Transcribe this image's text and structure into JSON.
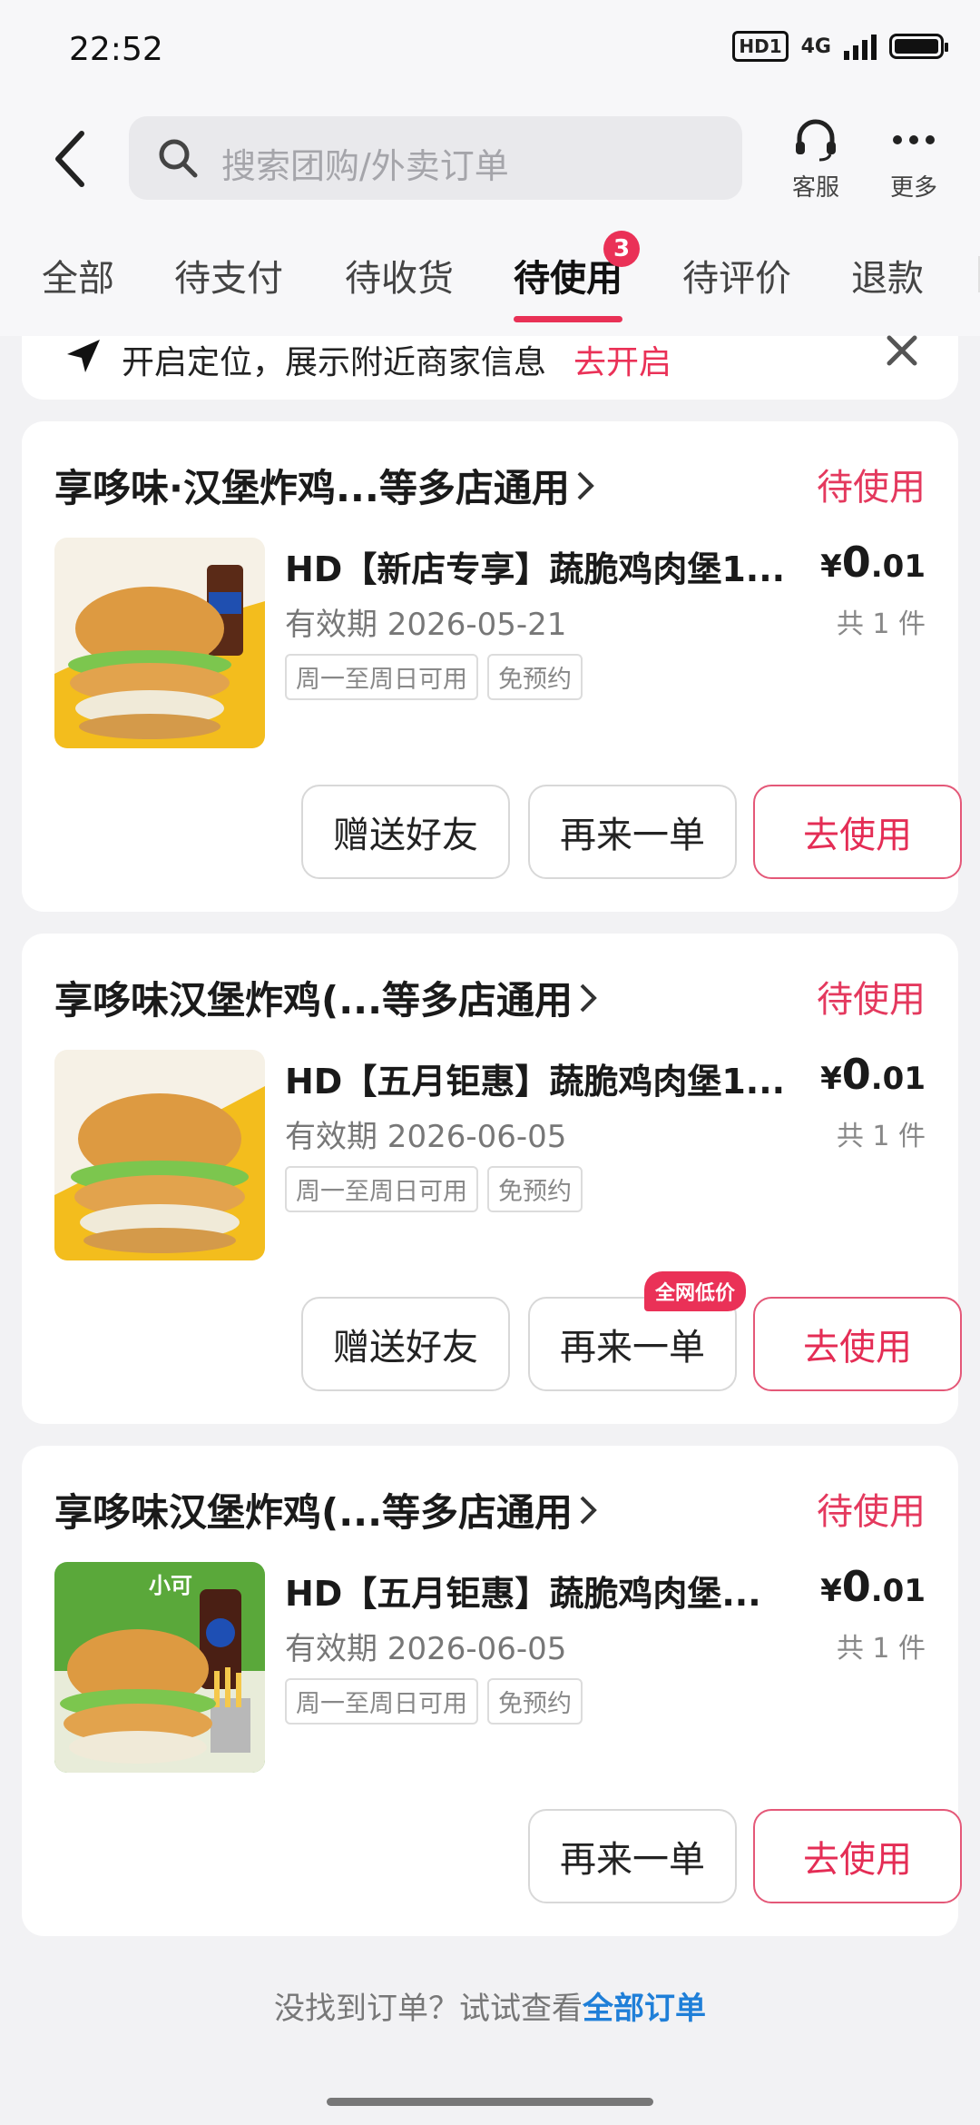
{
  "status_bar": {
    "time": "22:52",
    "hd_label": "HD1",
    "network": "4G"
  },
  "header": {
    "search_placeholder": "搜索团购/外卖订单",
    "service_label": "客服",
    "more_label": "更多"
  },
  "tabs": [
    {
      "label": "全部"
    },
    {
      "label": "待支付"
    },
    {
      "label": "待收货"
    },
    {
      "label": "待使用",
      "active": true,
      "badge": "3"
    },
    {
      "label": "待评价"
    },
    {
      "label": "退款"
    }
  ],
  "location_banner": {
    "text": "开启定位，展示附近商家信息",
    "action": "去开启"
  },
  "orders": [
    {
      "shop": "享哆味·汉堡炸鸡...等多店通用",
      "status": "待使用",
      "product": "HD【新店专享】蔬脆鸡肉堡1...",
      "price_currency": "¥",
      "price_int": "0",
      "price_dec": ".01",
      "quantity": "共 1 件",
      "validity": "有效期 2026-05-21",
      "tags": [
        "周一至周日可用",
        "免预约"
      ],
      "buttons": {
        "gift": "赠送好友",
        "reorder": "再来一单",
        "use": "去使用"
      }
    },
    {
      "shop": "享哆味汉堡炸鸡(...等多店通用",
      "status": "待使用",
      "product": "HD【五月钜惠】蔬脆鸡肉堡1...",
      "price_currency": "¥",
      "price_int": "0",
      "price_dec": ".01",
      "quantity": "共 1 件",
      "validity": "有效期 2026-06-05",
      "tags": [
        "周一至周日可用",
        "免预约"
      ],
      "promo": "全网低价",
      "buttons": {
        "gift": "赠送好友",
        "reorder": "再来一单",
        "use": "去使用"
      }
    },
    {
      "shop": "享哆味汉堡炸鸡(...等多店通用",
      "status": "待使用",
      "product": "HD【五月钜惠】蔬脆鸡肉堡...",
      "price_currency": "¥",
      "price_int": "0",
      "price_dec": ".01",
      "quantity": "共 1 件",
      "validity": "有效期 2026-06-05",
      "tags": [
        "周一至周日可用",
        "免预约"
      ],
      "image_text": "小可",
      "buttons": {
        "reorder": "再来一单",
        "use": "去使用"
      }
    }
  ],
  "footer": {
    "text": "没找到订单？试试查看",
    "link": "全部订单"
  },
  "colors": {
    "accent": "#e93156",
    "link": "#1f7fd8"
  }
}
